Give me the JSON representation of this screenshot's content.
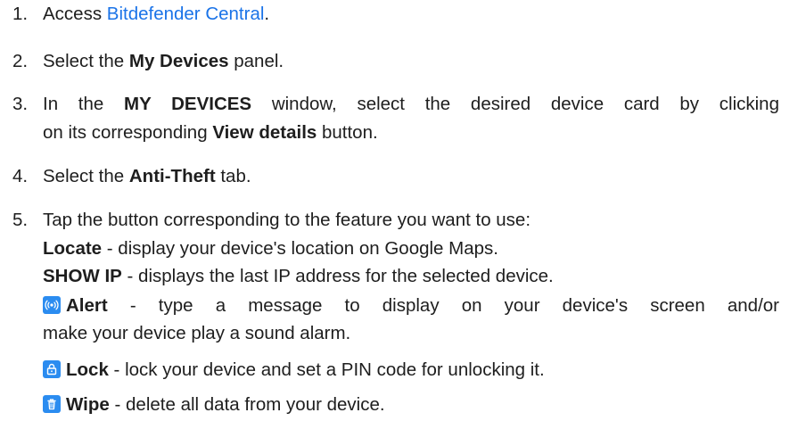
{
  "steps": [
    {
      "num": "1.",
      "pre": "Access ",
      "link": "Bitdefender Central",
      "post": "."
    },
    {
      "num": "2.",
      "pre": "Select the ",
      "bold": "My Devices",
      "post": " panel."
    },
    {
      "num": "3.",
      "pre": "In the ",
      "bold1": "MY DEVICES",
      "mid": " window, select the desired device card by clicking",
      "line2_pre": "on its corresponding ",
      "bold2": "View details",
      "post": " button."
    },
    {
      "num": "4.",
      "pre": "Select the ",
      "bold": "Anti-Theft",
      "post": " tab."
    },
    {
      "num": "5.",
      "text": "Tap the button corresponding to the feature you want to use:"
    }
  ],
  "features": {
    "locate": {
      "label": "Locate",
      "desc": " - display your device's location on Google Maps."
    },
    "showip": {
      "label": "SHOW IP",
      "desc": " - displays the last IP address for the selected device."
    },
    "alert": {
      "label": "Alert",
      "desc": " - type a message to display on your device's screen and/or",
      "desc2": "make your device play a sound alarm.",
      "icon": "alert-icon"
    },
    "lock": {
      "label": "Lock",
      "desc": " - lock your device and set a PIN code for unlocking it.",
      "icon": "lock-icon"
    },
    "wipe": {
      "label": "Wipe",
      "desc": " - delete all data from your device.",
      "icon": "wipe-icon"
    }
  },
  "colors": {
    "link": "#1a73e8",
    "icon_bg": "#2b8cf0",
    "text": "#1e1e1e"
  }
}
